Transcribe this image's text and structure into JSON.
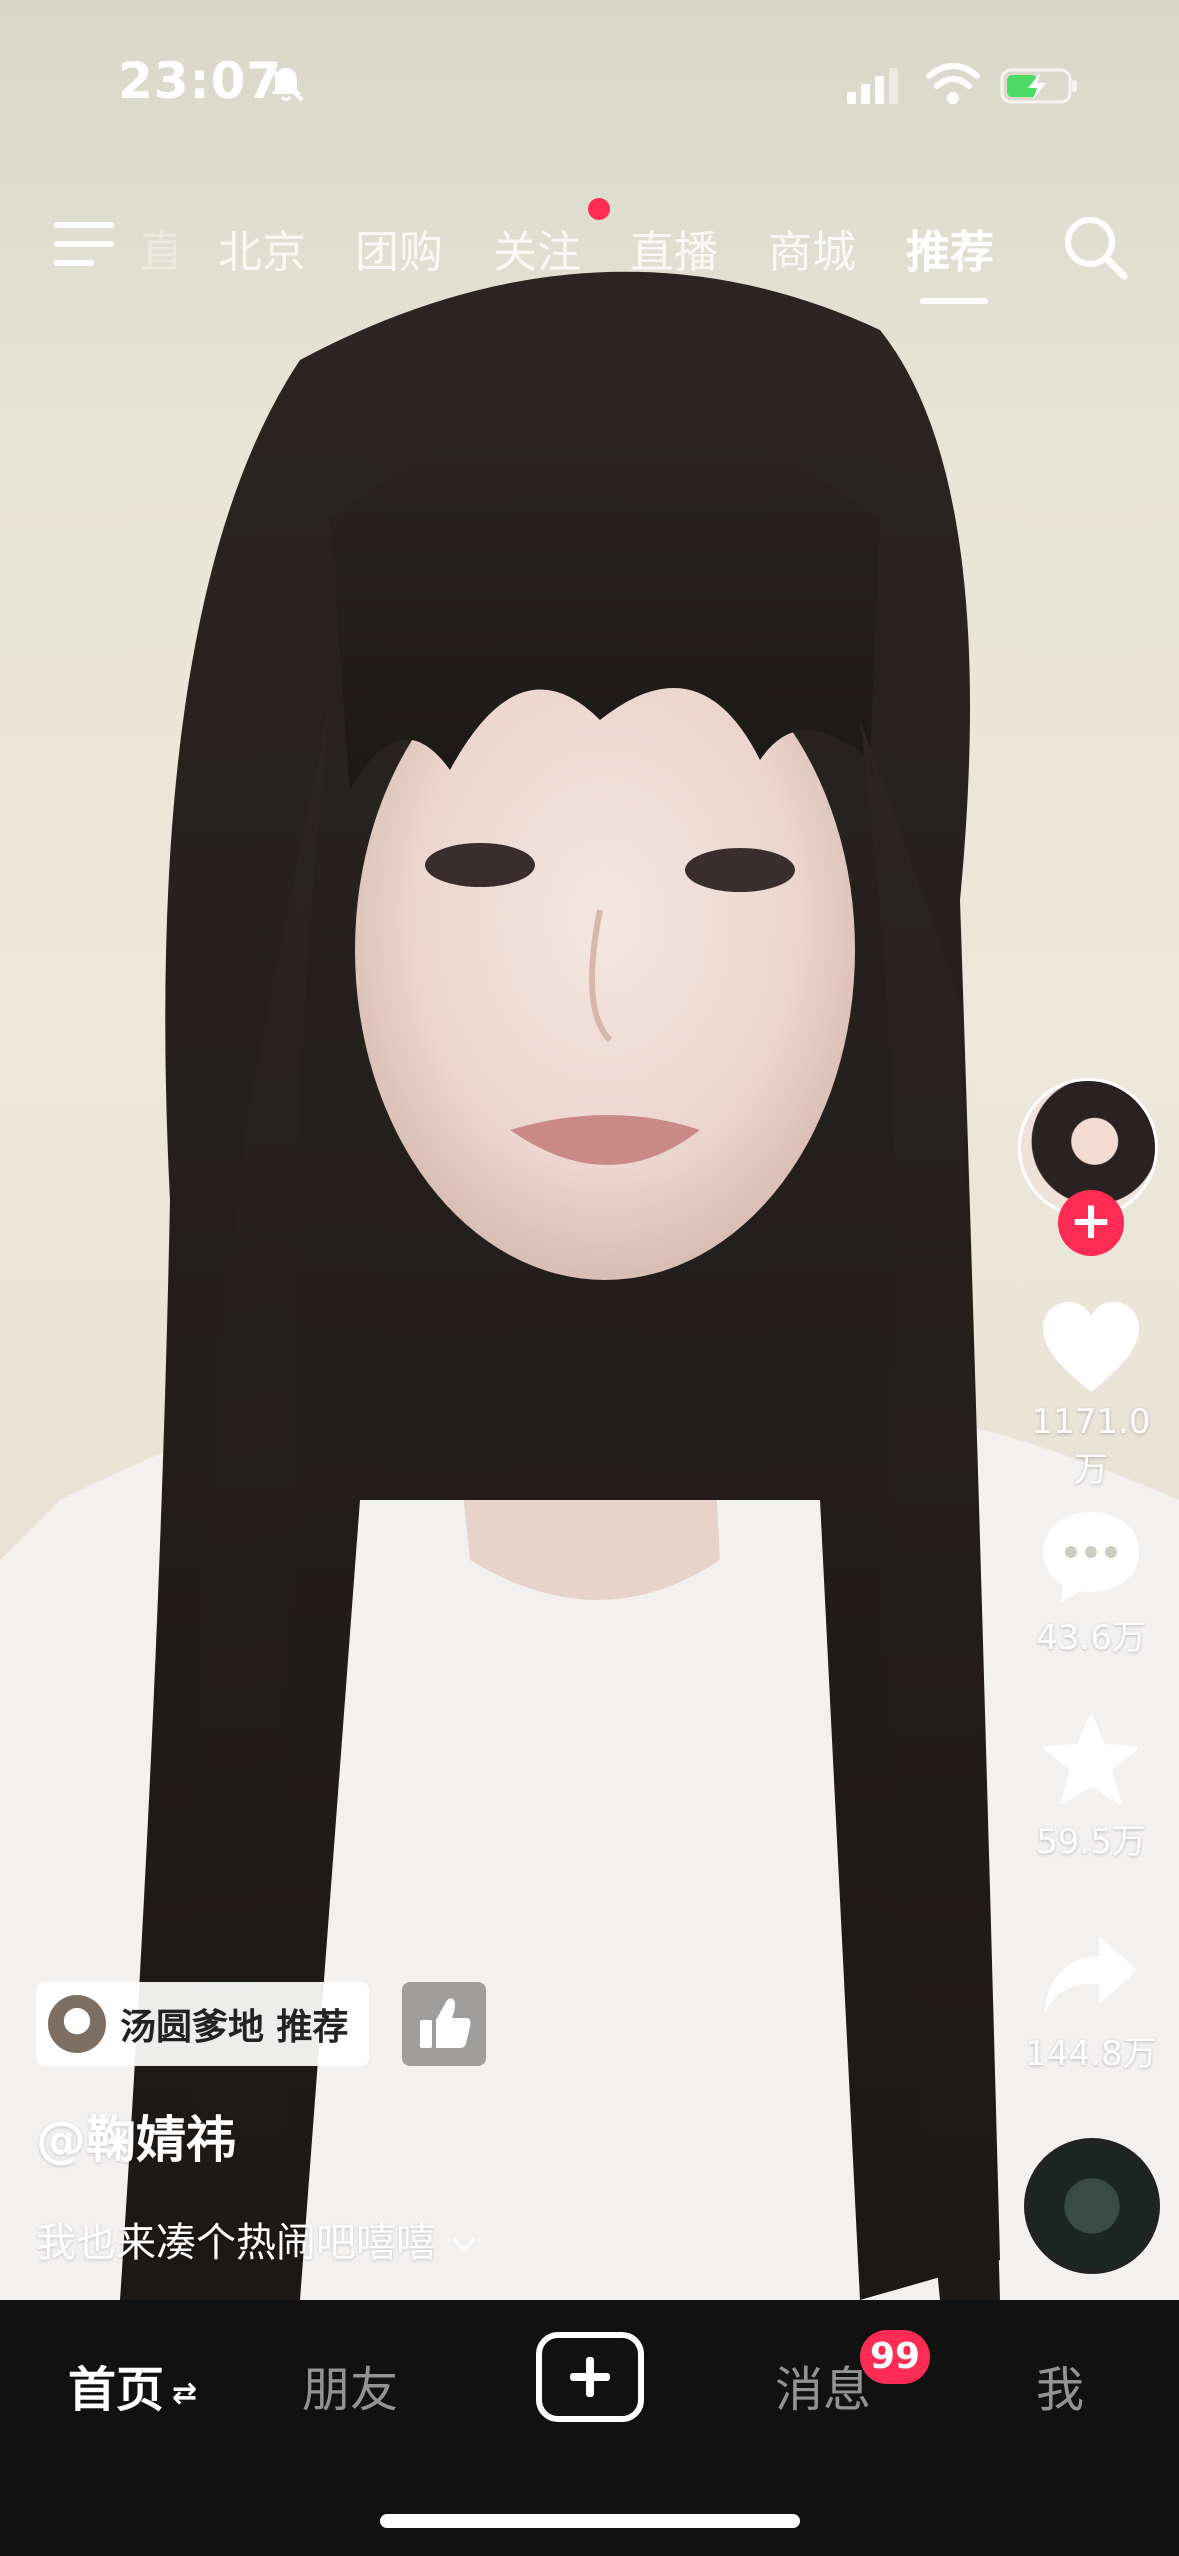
{
  "status_bar": {
    "time": "23:07"
  },
  "top_nav": {
    "tabs": [
      {
        "label": "直播"
      },
      {
        "label": "北京"
      },
      {
        "label": "团购"
      },
      {
        "label": "关注"
      },
      {
        "label": "直播"
      },
      {
        "label": "商城"
      },
      {
        "label": "推荐"
      }
    ],
    "active_tab": "推荐"
  },
  "actions": {
    "likes": "1171.0万",
    "comments": "43.6万",
    "favorites": "59.5万",
    "shares": "144.8万"
  },
  "video_info": {
    "recommend_tag": "汤圆爹地 推荐",
    "author": "@鞠婧祎",
    "caption": "我也来凑个热闹吧嘻嘻"
  },
  "tab_bar": {
    "home": "首页",
    "home_switch": "⇄",
    "friends": "朋友",
    "messages": "消息",
    "messages_badge": "99",
    "me": "我"
  },
  "colors": {
    "accent": "#fe2c55",
    "tab_bar_bg": "#111111"
  }
}
